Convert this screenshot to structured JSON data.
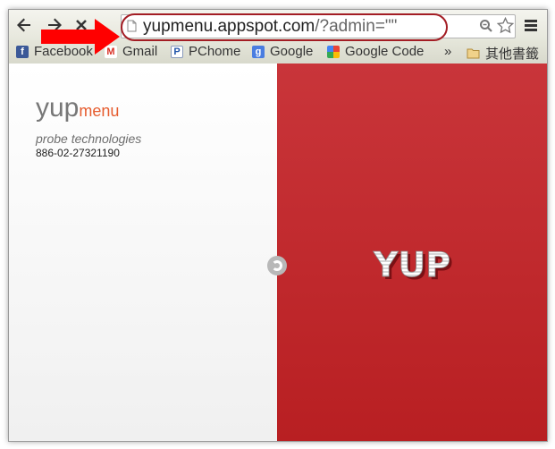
{
  "browser": {
    "url_host": "yupmenu.appspot.com",
    "url_rest": "/?admin=\"\""
  },
  "bookmarks": [
    {
      "label": "Facebook",
      "icon": "facebook-icon"
    },
    {
      "label": "Gmail",
      "icon": "gmail-icon"
    },
    {
      "label": "PChome",
      "icon": "pchome-icon"
    },
    {
      "label": "Google",
      "icon": "google-icon"
    },
    {
      "label": "Google Code",
      "icon": "google-code-icon"
    }
  ],
  "bookmarks_overflow": "»",
  "other_bookmarks": "其他書籤",
  "page": {
    "brand_yup": "yup",
    "brand_menu": "menu",
    "tagline": "probe technologies",
    "phone": "886-02-27321190",
    "logo_text": "YUP"
  },
  "colors": {
    "accent_red": "#c0292d",
    "brand_orange": "#e65c2e",
    "annotation_red": "#ff0000"
  }
}
